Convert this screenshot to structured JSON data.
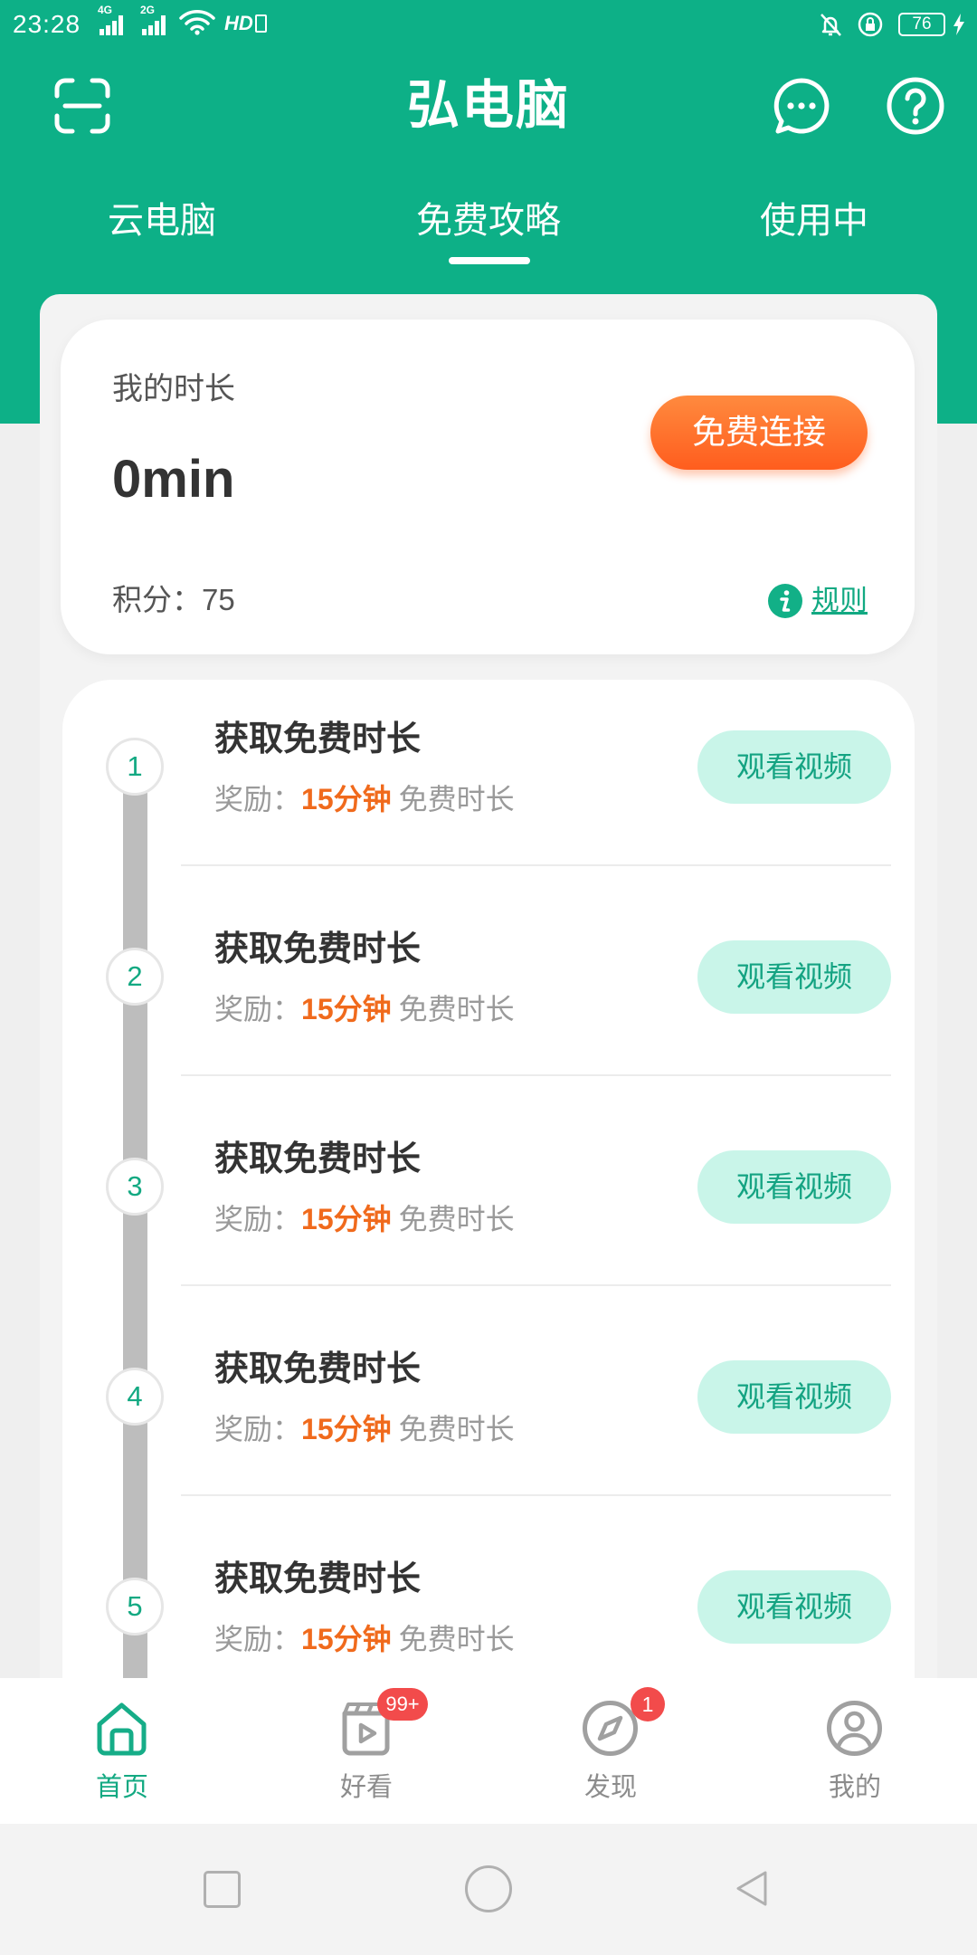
{
  "status_bar": {
    "time": "23:28",
    "signal_1_label": "4G",
    "signal_2_label": "2G",
    "hd_label": "HD",
    "battery": "76"
  },
  "header": {
    "title": "弘电脑",
    "left_icon": "scan-icon",
    "right_icons": [
      "message-icon",
      "help-icon"
    ]
  },
  "tabs": [
    {
      "label": "云电脑",
      "active": false
    },
    {
      "label": "免费攻略",
      "active": true
    },
    {
      "label": "使用中",
      "active": false
    }
  ],
  "summary": {
    "duration_label": "我的时长",
    "duration_value": "0min",
    "connect_button": "免费连接",
    "points_label": "积分：",
    "points_value": "75",
    "rules_icon": "info-icon",
    "rules_link": "规则"
  },
  "tasks": [
    {
      "step": "1",
      "title": "获取免费时长",
      "reward_prefix": "奖励：",
      "reward_amount": "15分钟",
      "reward_unit": "免费时长",
      "action": "观看视频"
    },
    {
      "step": "2",
      "title": "获取免费时长",
      "reward_prefix": "奖励：",
      "reward_amount": "15分钟",
      "reward_unit": "免费时长",
      "action": "观看视频"
    },
    {
      "step": "3",
      "title": "获取免费时长",
      "reward_prefix": "奖励：",
      "reward_amount": "15分钟",
      "reward_unit": "免费时长",
      "action": "观看视频"
    },
    {
      "step": "4",
      "title": "获取免费时长",
      "reward_prefix": "奖励：",
      "reward_amount": "15分钟",
      "reward_unit": "免费时长",
      "action": "观看视频"
    },
    {
      "step": "5",
      "title": "获取免费时长",
      "reward_prefix": "奖励：",
      "reward_amount": "15分钟",
      "reward_unit": "免费时长",
      "action": "观看视频"
    }
  ],
  "bottom_nav": [
    {
      "label": "首页",
      "icon": "home-icon",
      "active": true
    },
    {
      "label": "好看",
      "icon": "video-icon",
      "badge": "99+"
    },
    {
      "label": "发现",
      "icon": "compass-icon",
      "badge": "1"
    },
    {
      "label": "我的",
      "icon": "user-icon"
    }
  ],
  "system_nav": {
    "icons": [
      "recent-apps-icon",
      "home-circle-icon",
      "back-triangle-icon"
    ]
  },
  "colors": {
    "brand_green": "#0db087",
    "accent_orange": "#ff6a24",
    "reward_orange": "#f06a1c",
    "button_mint": "#c9f5e9",
    "badge_red": "#f24b4b"
  }
}
